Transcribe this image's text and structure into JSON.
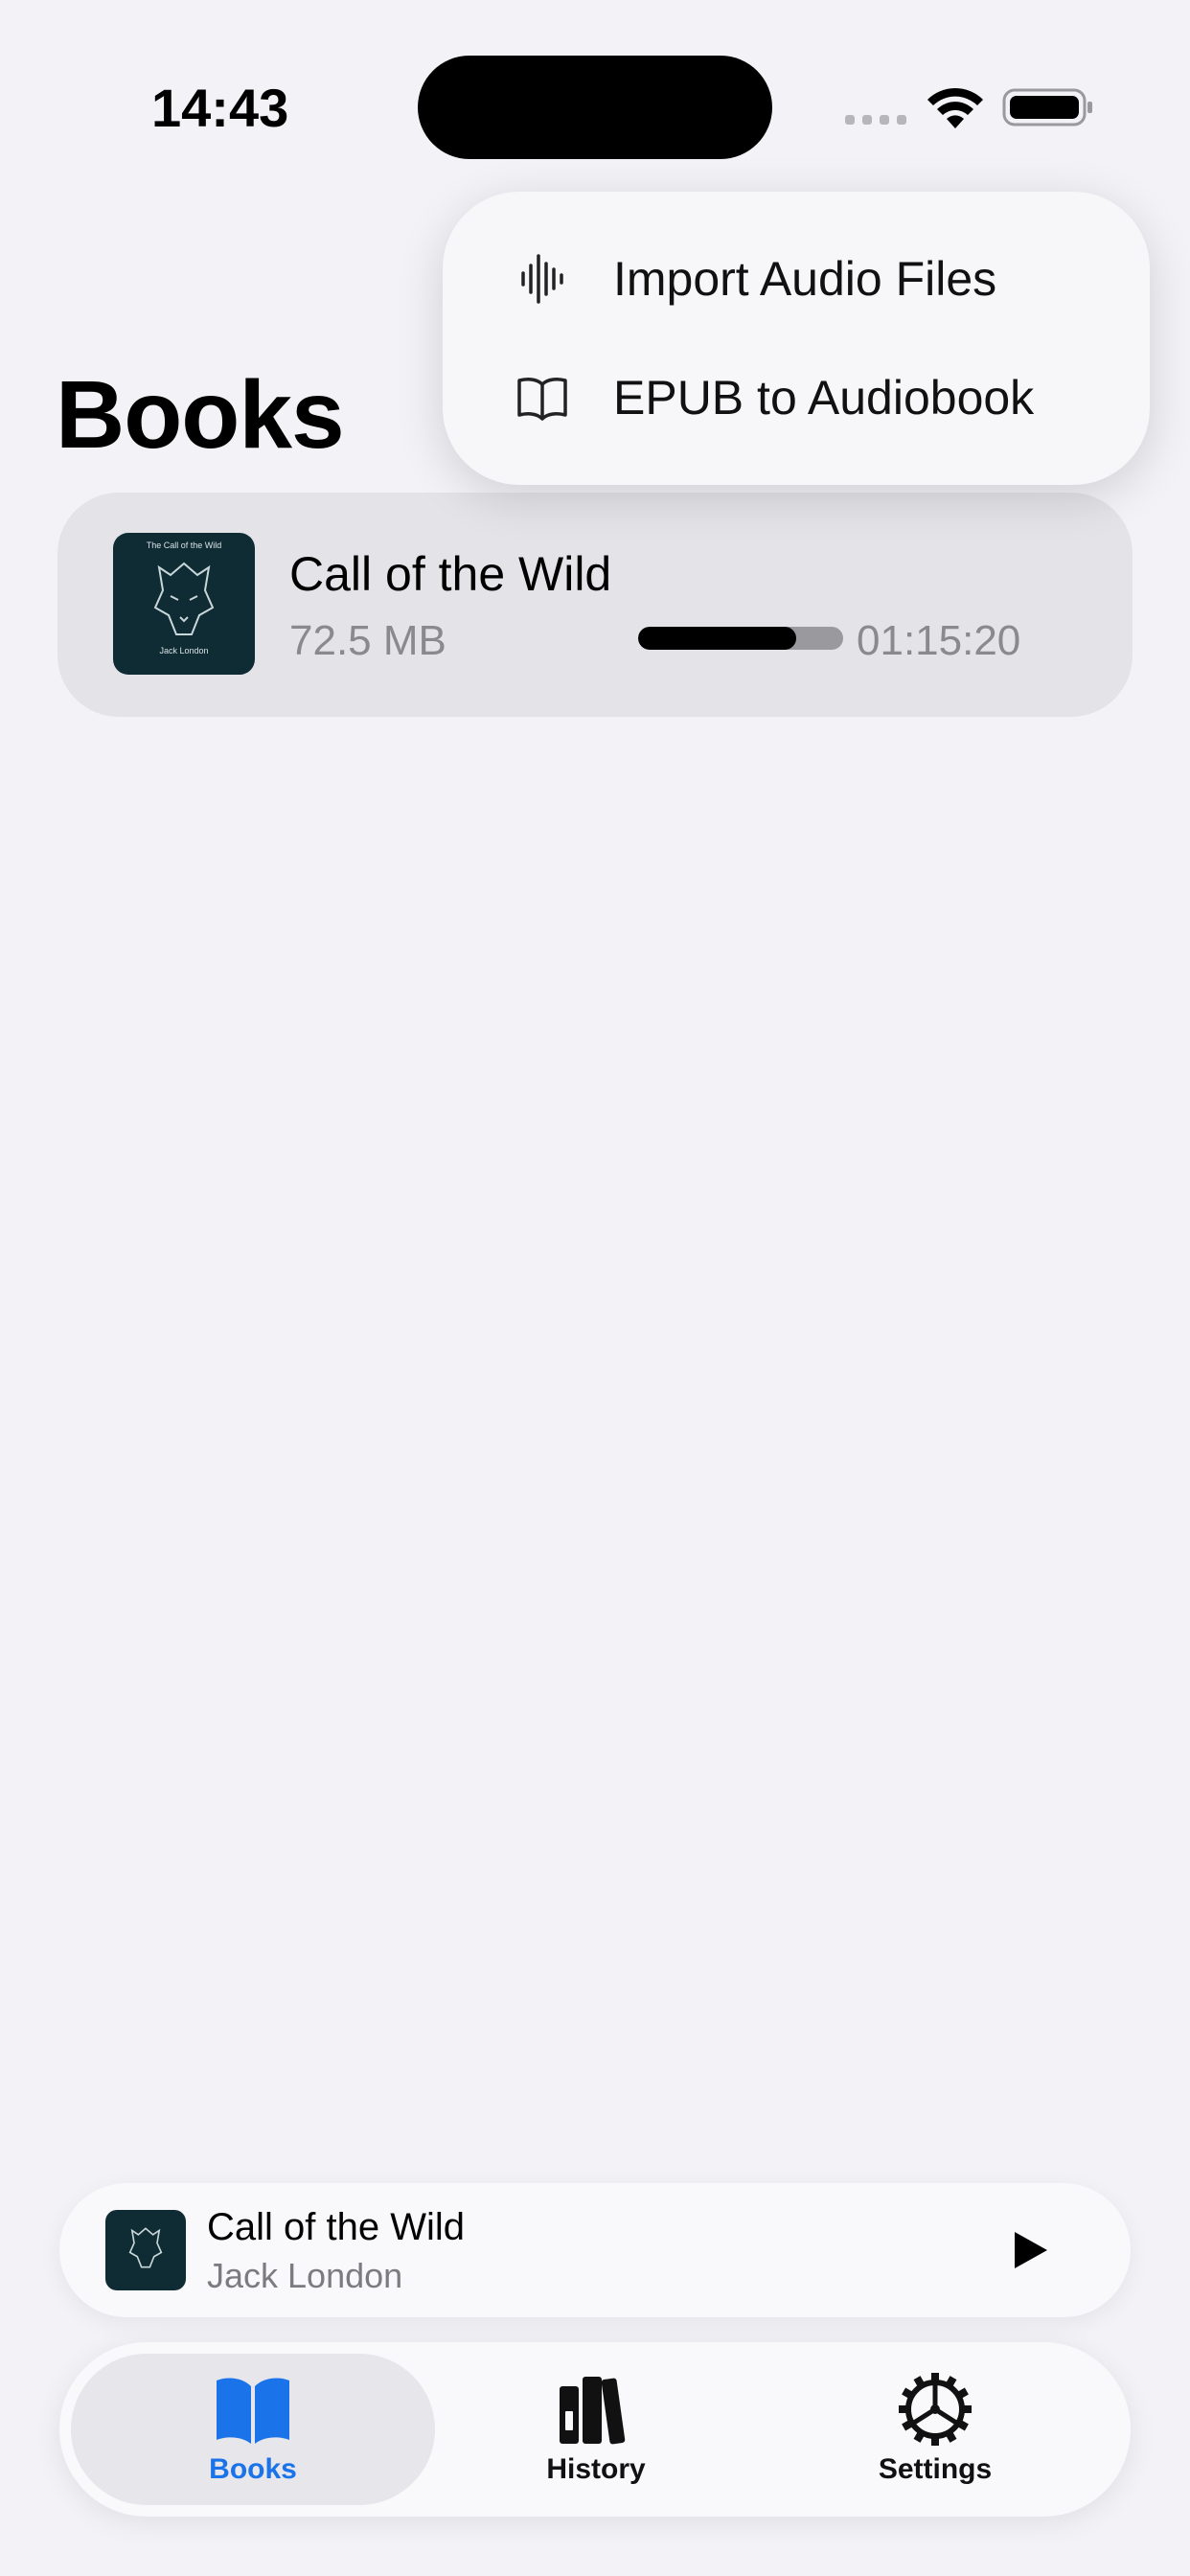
{
  "status_bar": {
    "time": "14:43"
  },
  "page": {
    "title": "Books"
  },
  "menu": {
    "items": [
      {
        "label": "Import Audio Files",
        "icon": "waveform-icon"
      },
      {
        "label": "EPUB to Audiobook",
        "icon": "book-icon"
      }
    ]
  },
  "book": {
    "title": "Call of the Wild",
    "size": "72.5 MB",
    "duration": "01:15:20",
    "progress_fraction": 0.77,
    "cover_title": "The Call of the Wild",
    "cover_author": "Jack London"
  },
  "mini_player": {
    "title": "Call of the Wild",
    "author": "Jack London"
  },
  "tab_bar": {
    "tabs": [
      {
        "label": "Books",
        "icon": "book-open-icon",
        "active": true
      },
      {
        "label": "History",
        "icon": "library-icon",
        "active": false
      },
      {
        "label": "Settings",
        "icon": "gear-icon",
        "active": false
      }
    ]
  },
  "colors": {
    "background": "#f2f2f7",
    "accent": "#1a73e8",
    "card": "#e3e3e8",
    "cover": "#0f2b33"
  }
}
